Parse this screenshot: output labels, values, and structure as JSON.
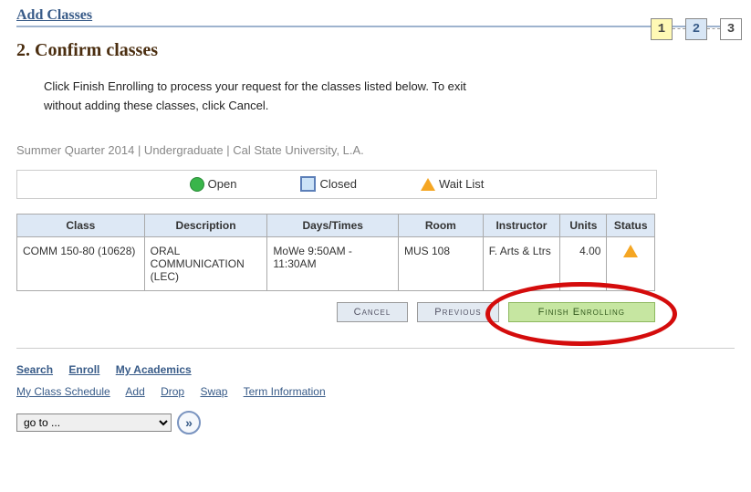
{
  "header": {
    "title": "Add Classes"
  },
  "steps": {
    "s1": "1",
    "s2": "2",
    "s3": "3"
  },
  "section": {
    "title": "2.  Confirm classes"
  },
  "instruction": {
    "line1": "Click Finish Enrolling to process your request for the classes listed below. To exit",
    "line2": "without adding these classes, click Cancel."
  },
  "term_line": "Summer Quarter 2014 | Undergraduate | Cal State University, L.A.",
  "legend": {
    "open": "Open",
    "closed": "Closed",
    "waitlist": "Wait List"
  },
  "table": {
    "headers": {
      "class": "Class",
      "description": "Description",
      "days": "Days/Times",
      "room": "Room",
      "instructor": "Instructor",
      "units": "Units",
      "status": "Status"
    },
    "rows": [
      {
        "class": "COMM 150-80 (10628)",
        "description": "ORAL COMMUNICATION (LEC)",
        "days": "MoWe 9:50AM - 11:30AM",
        "room": "MUS 108",
        "instructor": "F. Arts & Ltrs",
        "units": "4.00",
        "status": "waitlist"
      }
    ]
  },
  "buttons": {
    "cancel": "Cancel",
    "previous": "Previous",
    "finish": "Finish Enrolling"
  },
  "bottom_nav": {
    "primary": {
      "search": "Search",
      "enroll": "Enroll",
      "academics": "My Academics"
    },
    "secondary": {
      "schedule": "My Class Schedule",
      "add": "Add",
      "drop": "Drop",
      "swap": "Swap",
      "term": "Term Information"
    }
  },
  "goto": {
    "placeholder": "go to ...",
    "arrow": "»"
  }
}
